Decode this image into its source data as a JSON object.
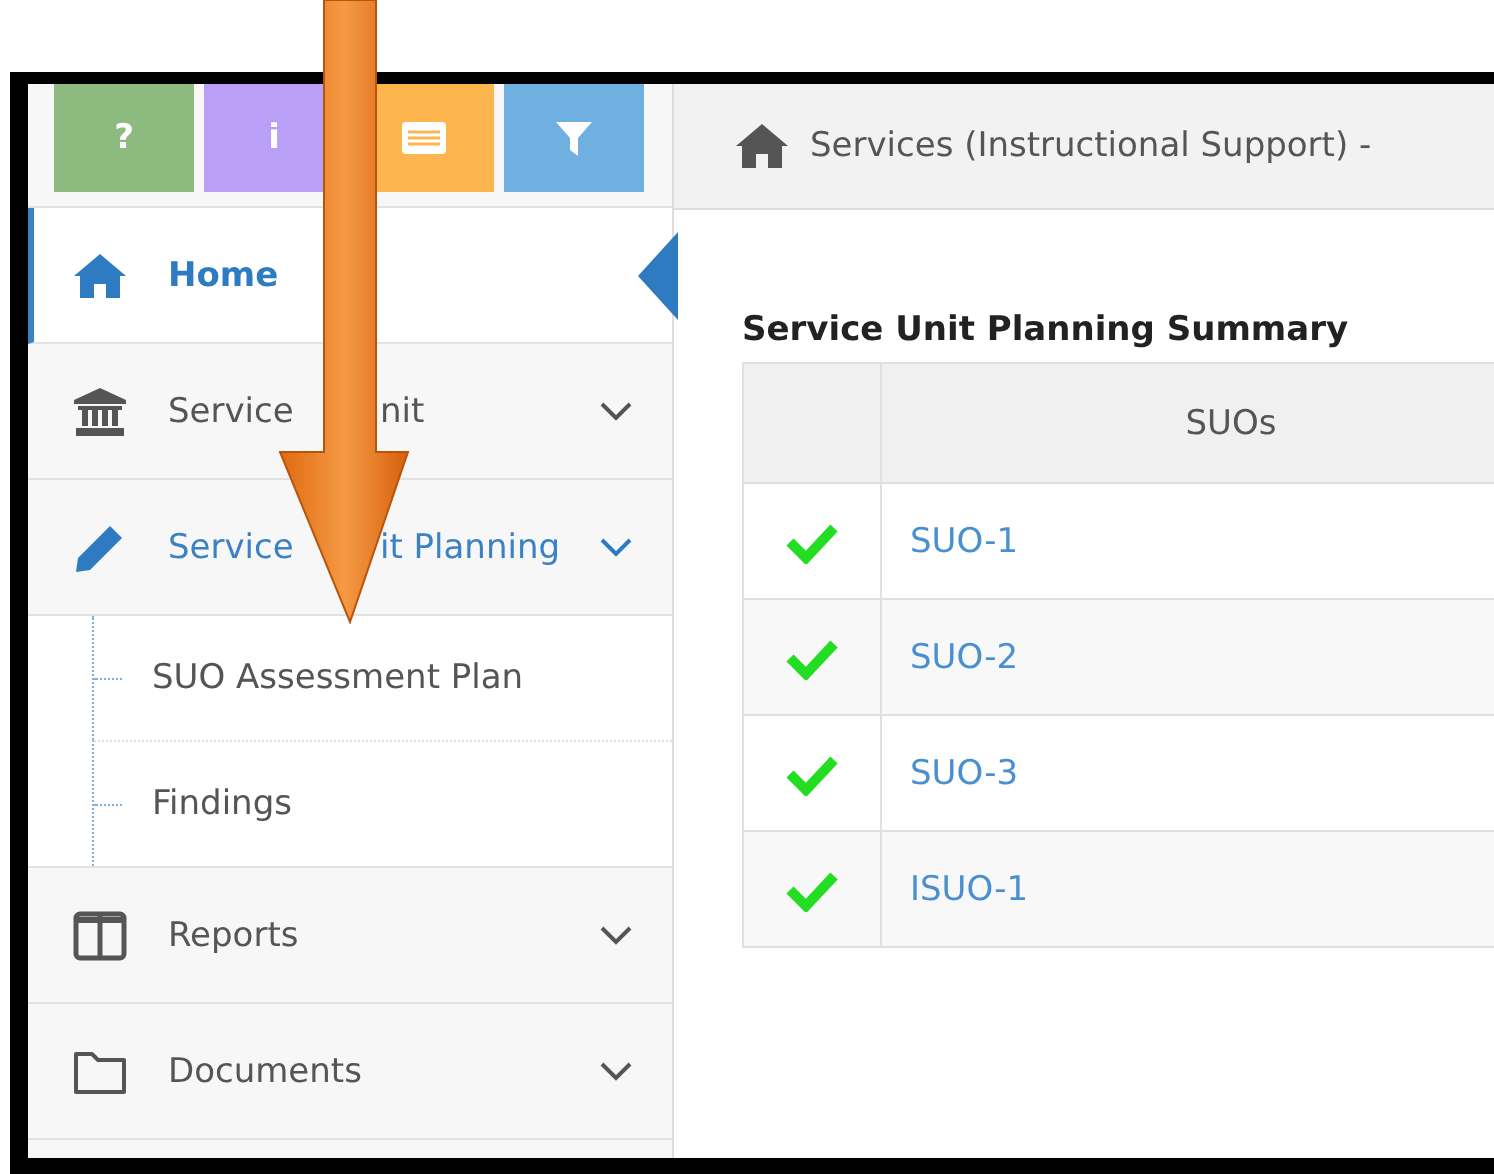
{
  "toolbar": [
    {
      "kind": "help",
      "label": "?",
      "color": "#8cba7f"
    },
    {
      "kind": "info",
      "label": "i",
      "color": "#b9a0f6"
    },
    {
      "kind": "list",
      "color": "#fdb54e"
    },
    {
      "kind": "filter",
      "color": "#6fb0e0"
    }
  ],
  "sidebar": {
    "items": [
      {
        "label": "Home",
        "kind": "home",
        "selected": true
      },
      {
        "label_parts": [
          "Service",
          "nit"
        ],
        "kind": "bank",
        "selected": false,
        "expanded": false
      },
      {
        "label_parts": [
          "Service",
          "it Planning"
        ],
        "kind": "pencil",
        "selected": false,
        "expanded": true,
        "children": [
          {
            "label": "SUO Assessment Plan"
          },
          {
            "label": "Findings"
          }
        ]
      },
      {
        "label": "Reports",
        "kind": "columns",
        "selected": false,
        "expanded": false
      },
      {
        "label": "Documents",
        "kind": "folder",
        "selected": false,
        "expanded": false
      }
    ]
  },
  "breadcrumb": "Services (Instructional Support) -",
  "summary": {
    "title": "Service Unit Planning Summary",
    "columns": [
      "SUOs"
    ],
    "rows": [
      {
        "done": true,
        "label": "SUO-1"
      },
      {
        "done": true,
        "label": "SUO-2"
      },
      {
        "done": true,
        "label": "SUO-3"
      },
      {
        "done": true,
        "label": "ISUO-1"
      }
    ]
  },
  "annotation": {
    "kind": "arrow-down"
  }
}
